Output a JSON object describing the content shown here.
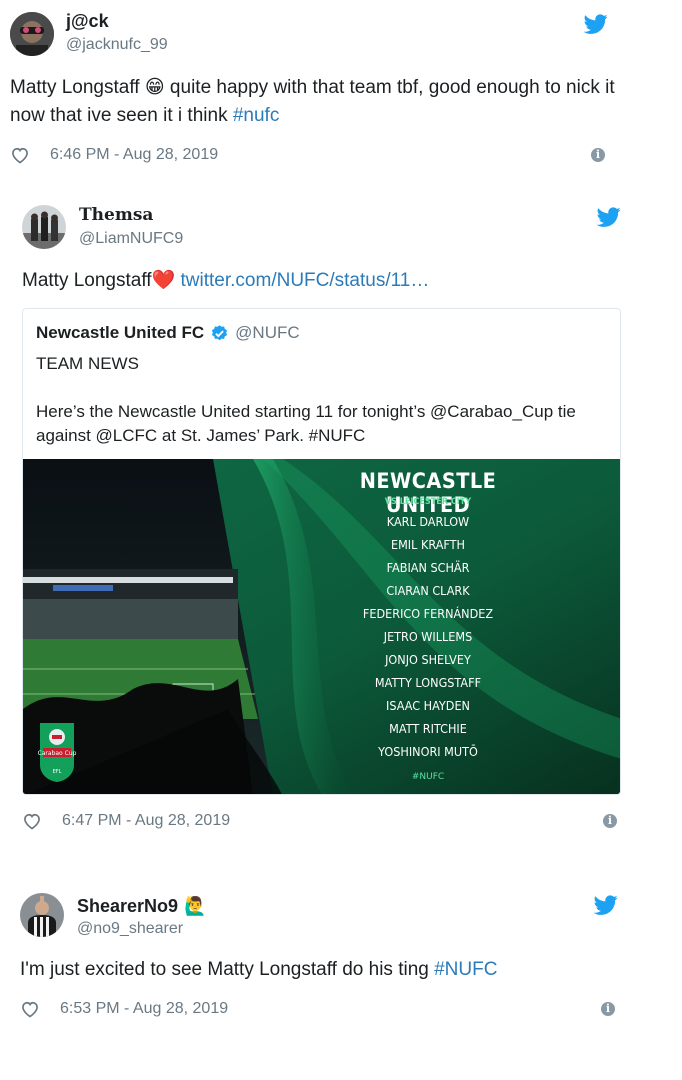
{
  "tweets": [
    {
      "display_name": "j@ck",
      "handle": "@jacknufc_99",
      "text_before": "Matty Longstaff ",
      "emoji": "😁",
      "text_after": " quite happy with that team tbf, good enough to nick it now that ive seen it i think ",
      "hashtag": "#nufc",
      "timestamp": "6:46 PM - Aug 28, 2019"
    },
    {
      "display_name": "Themsa",
      "handle": "@LiamNUFC9",
      "text_before": "Matty Longstaff",
      "emoji": "❤️",
      "link": "twitter.com/NUFC/status/11…",
      "timestamp": "6:47 PM - Aug 28, 2019",
      "quote": {
        "display_name": "Newcastle United FC",
        "handle": "@NUFC",
        "line1": "TEAM NEWS",
        "line2": "Here’s the Newcastle United starting 11 for tonight’s @Carabao_Cup tie against @LCFC at St. James’ Park. #NUFC",
        "image": {
          "title": "NEWCASTLE UNITED",
          "subtitle": "VS LEICESTER CITY",
          "players": [
            "KARL DARLOW",
            "EMIL KRAFTH",
            "FABIAN SCHÄR",
            "CIARAN CLARK",
            "FEDERICO FERNÁNDEZ",
            "JETRO WILLEMS",
            "JONJO SHELVEY",
            "MATTY LONGSTAFF",
            "ISAAC HAYDEN",
            "MATT RITCHIE",
            "YOSHINORI MUTŌ"
          ],
          "tag": "#NUFC",
          "logo_text": "Carabao Cup",
          "logo_sub": "EFL"
        }
      }
    },
    {
      "display_name": "ShearerNo9",
      "handle": "@no9_shearer",
      "name_emoji": "🙋‍♂️",
      "text_before": "I'm just excited to see Matty Longstaff do his ting ",
      "hashtag": "#NUFC",
      "timestamp": "6:53 PM - Aug 28, 2019"
    }
  ],
  "icons": {
    "brand": "twitter-bird-icon",
    "like": "heart-icon",
    "info": "info-icon",
    "verified": "verified-badge-icon"
  },
  "colors": {
    "twitter_blue": "#1da1f2",
    "link": "#2b7bb9",
    "muted": "#697882",
    "heart_red": "#e0245e",
    "pitch_green": "#1a9a5c"
  }
}
